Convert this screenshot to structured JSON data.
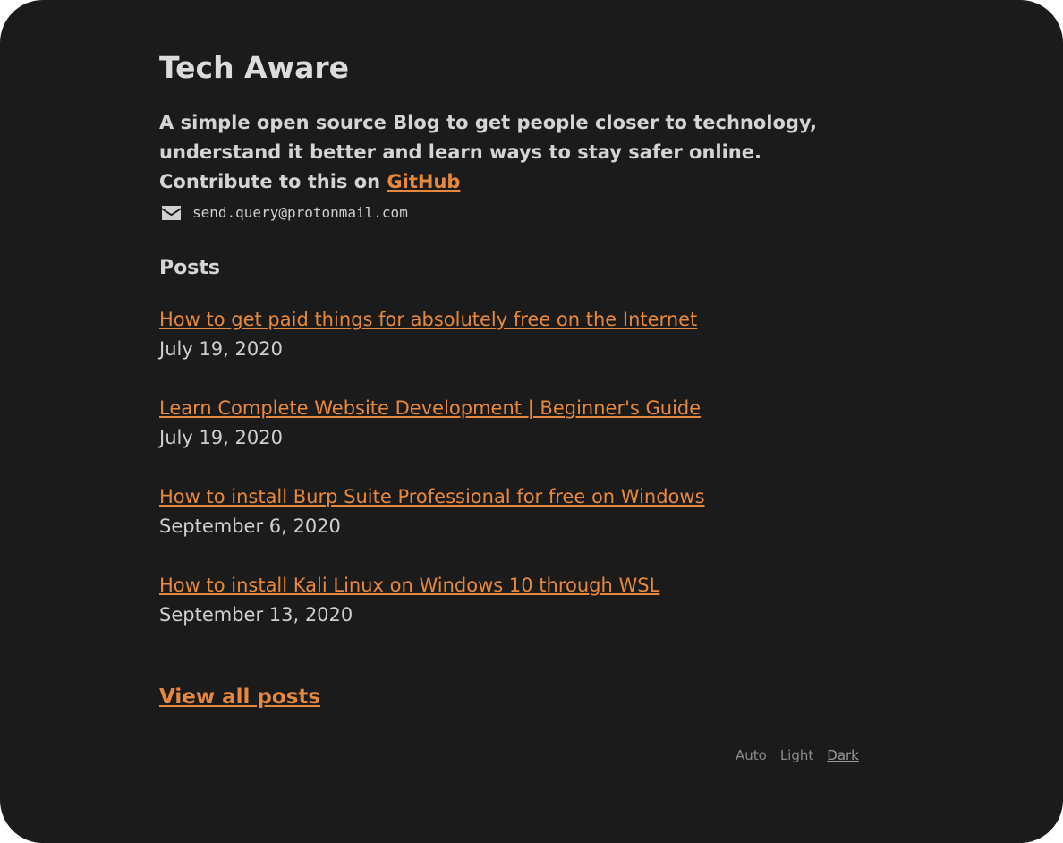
{
  "site": {
    "title": "Tech Aware",
    "tagline": "A simple open source Blog to get people closer to technology, understand it better and learn ways to stay safer online. Contribute to this on",
    "github_label": "GitHub"
  },
  "contact": {
    "icon": "envelope-icon",
    "email": "send.query@protonmail.com"
  },
  "posts": {
    "heading": "Posts",
    "items": [
      {
        "title": "How to get paid things for absolutely free on the Internet",
        "date": "July 19, 2020"
      },
      {
        "title": "Learn Complete Website Development | Beginner's Guide",
        "date": "July 19, 2020"
      },
      {
        "title": "How to install Burp Suite Professional for free on Windows",
        "date": "September 6, 2020"
      },
      {
        "title": "How to install Kali Linux on Windows 10 through WSL",
        "date": "September 13, 2020"
      }
    ],
    "view_all_label": "View all posts"
  },
  "theme": {
    "options": [
      "Auto",
      "Light",
      "Dark"
    ],
    "selected": "Dark"
  },
  "colors": {
    "background": "#1b1b1b",
    "accent": "#e8883a",
    "text": "#d4d4d4"
  }
}
